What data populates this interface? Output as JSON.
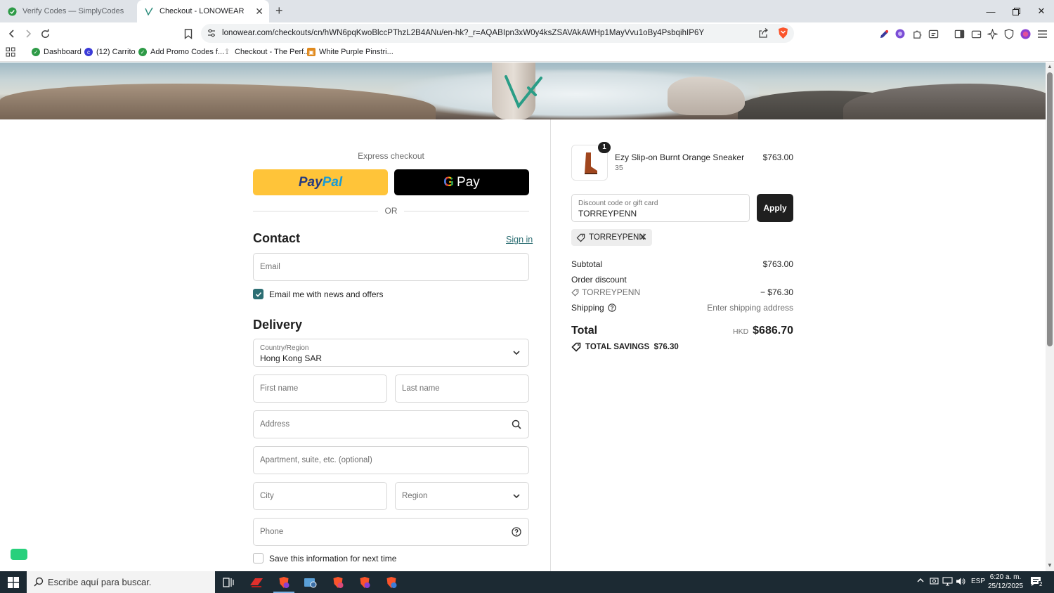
{
  "browser": {
    "tabs": [
      {
        "title": "Verify Codes — SimplyCodes",
        "active": false
      },
      {
        "title": "Checkout - LONOWEAR",
        "active": true
      }
    ],
    "url": "lonowear.com/checkouts/cn/hWN6pqKwoBlccPThzL2B4ANu/en-hk?_r=AQABIpn3xW0y4ksZSAVAkAWHp1MayVvu1oBy4PsbqihIP6Y",
    "bookmarks": [
      {
        "label": "Dashboard",
        "color": "#2e9b47"
      },
      {
        "label": "(12) Carrito",
        "color": "#3b3bd8"
      },
      {
        "label": "Add Promo Codes f...",
        "color": "#2e9b47"
      },
      {
        "label": "Checkout - The Perf...",
        "color": "#555555"
      },
      {
        "label": "White Purple Pinstri...",
        "color": "#e08a1e"
      }
    ]
  },
  "checkout": {
    "express_label": "Express checkout",
    "paypal": {
      "part1": "Pay",
      "part2": "Pal"
    },
    "gpay": {
      "g": "G",
      "label": "Pay"
    },
    "or_label": "OR",
    "contact": {
      "heading": "Contact",
      "signin": "Sign in",
      "email_placeholder": "Email",
      "newsletter_label": "Email me with news and offers",
      "newsletter_checked": true
    },
    "delivery": {
      "heading": "Delivery",
      "country_label": "Country/Region",
      "country_value": "Hong Kong SAR",
      "first_name_placeholder": "First name",
      "last_name_placeholder": "Last name",
      "address_placeholder": "Address",
      "apartment_placeholder": "Apartment, suite, etc. (optional)",
      "city_placeholder": "City",
      "region_placeholder": "Region",
      "phone_placeholder": "Phone",
      "save_info_label": "Save this information for next time",
      "save_info_checked": false
    }
  },
  "summary": {
    "item": {
      "quantity": "1",
      "name": "Ezy Slip-on Burnt Orange Sneaker",
      "variant": "35",
      "price": "$763.00"
    },
    "discount_label": "Discount code or gift card",
    "discount_value": "TORREYPENN",
    "apply_label": "Apply",
    "applied_code": "TORREYPENN",
    "subtotal_label": "Subtotal",
    "subtotal_value": "$763.00",
    "order_discount_label": "Order discount",
    "order_discount_code": "TORREYPENN",
    "order_discount_value": "− $76.30",
    "shipping_label": "Shipping",
    "shipping_value": "Enter shipping address",
    "total_label": "Total",
    "total_currency": "HKD",
    "total_value": "$686.70",
    "savings_label": "TOTAL SAVINGS",
    "savings_value": "$76.30"
  },
  "taskbar": {
    "search_placeholder": "Escribe aquí para buscar.",
    "language": "ESP",
    "time": "6:20 a. m.",
    "date": "25/12/2025",
    "notifications": "2"
  },
  "colors": {
    "accent": "#2c6e73",
    "paypal": "#ffc439",
    "dark": "#1f1f1f"
  }
}
